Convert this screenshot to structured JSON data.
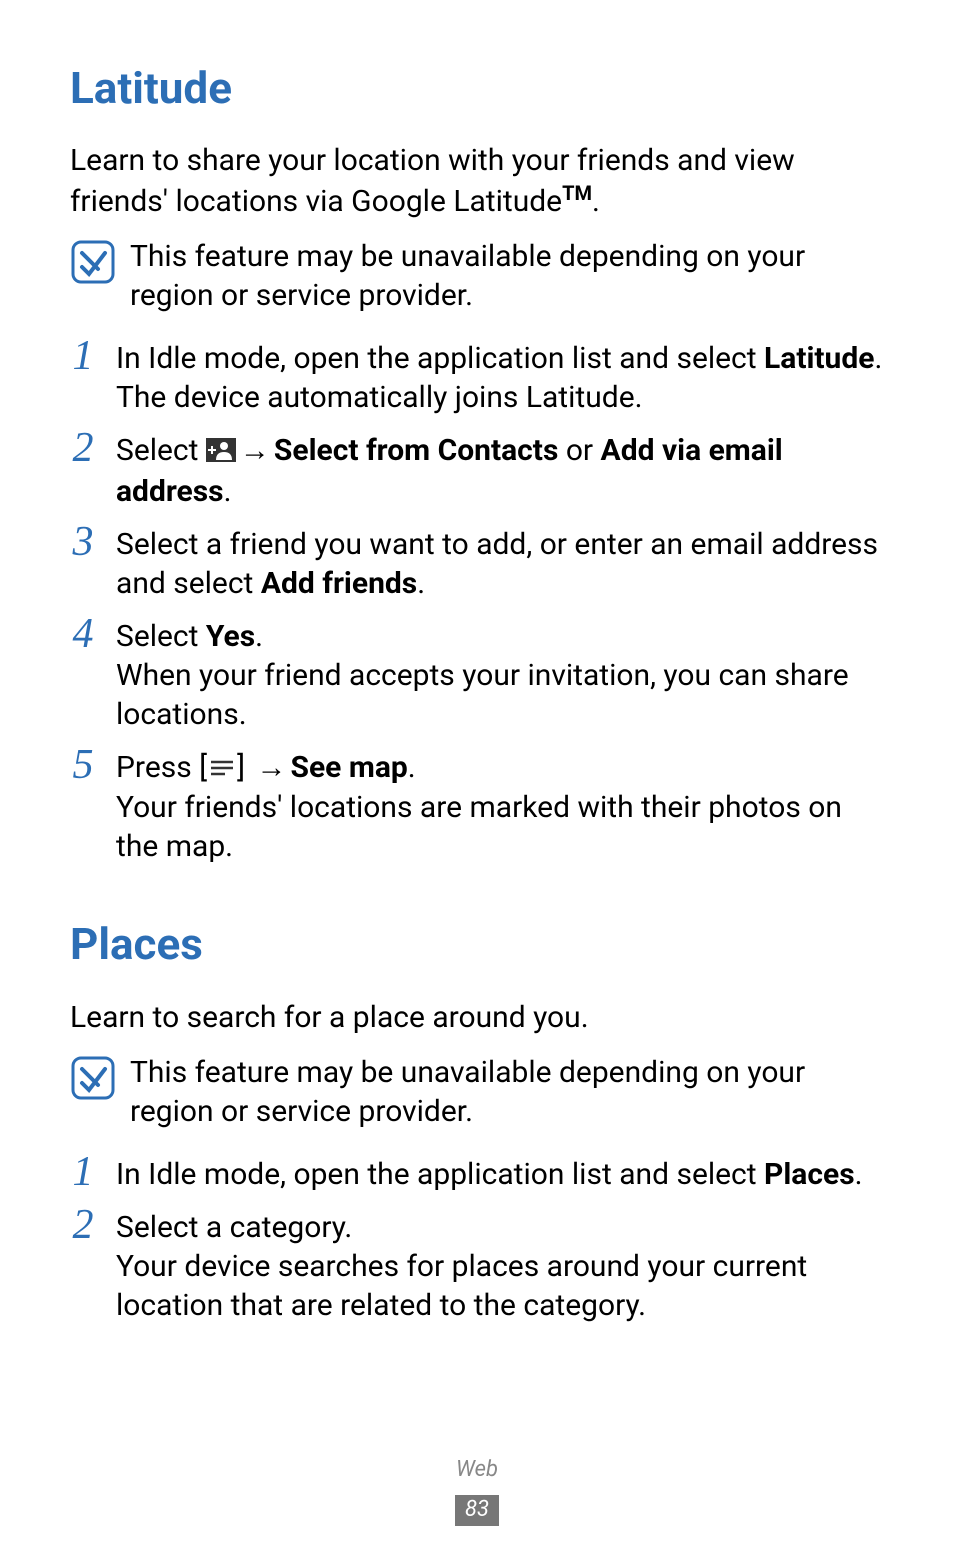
{
  "section1": {
    "title": "Latitude",
    "intro_a": "Learn to share your location with your friends and view friends' locations via Google Latitude",
    "intro_b": ".",
    "tm": "TM",
    "note": "This feature may be unavailable depending on your region or service provider.",
    "step1": {
      "num": "1",
      "text_a": "In Idle mode, open the application list and select ",
      "bold_a": "Latitude",
      "text_b": ". The device automatically joins Latitude."
    },
    "step2": {
      "num": "2",
      "text_a": "Select ",
      "arrow": " → ",
      "bold_a": "Select from Contacts",
      "text_b": " or ",
      "bold_b": "Add via email address",
      "text_c": "."
    },
    "step3": {
      "num": "3",
      "text_a": "Select a friend you want to add, or enter an email address and select ",
      "bold_a": "Add friends",
      "text_b": "."
    },
    "step4": {
      "num": "4",
      "text_a": "Select ",
      "bold_a": "Yes",
      "text_b": ".",
      "text_c": "When your friend accepts your invitation, you can share locations."
    },
    "step5": {
      "num": "5",
      "text_a": "Press [",
      "text_b": "] ",
      "arrow": "→ ",
      "bold_a": "See map",
      "text_c": ".",
      "text_d": "Your friends' locations are marked with their photos on the map."
    }
  },
  "section2": {
    "title": "Places",
    "intro": "Learn to search for a place around you.",
    "note": "This feature may be unavailable depending on your region or service provider.",
    "step1": {
      "num": "1",
      "text_a": "In Idle mode, open the application list and select ",
      "bold_a": "Places",
      "text_b": "."
    },
    "step2": {
      "num": "2",
      "text_a": "Select a category.",
      "text_b": "Your device searches for places around your current location that are related to the category."
    }
  },
  "footer": {
    "label": "Web",
    "page": "83"
  }
}
